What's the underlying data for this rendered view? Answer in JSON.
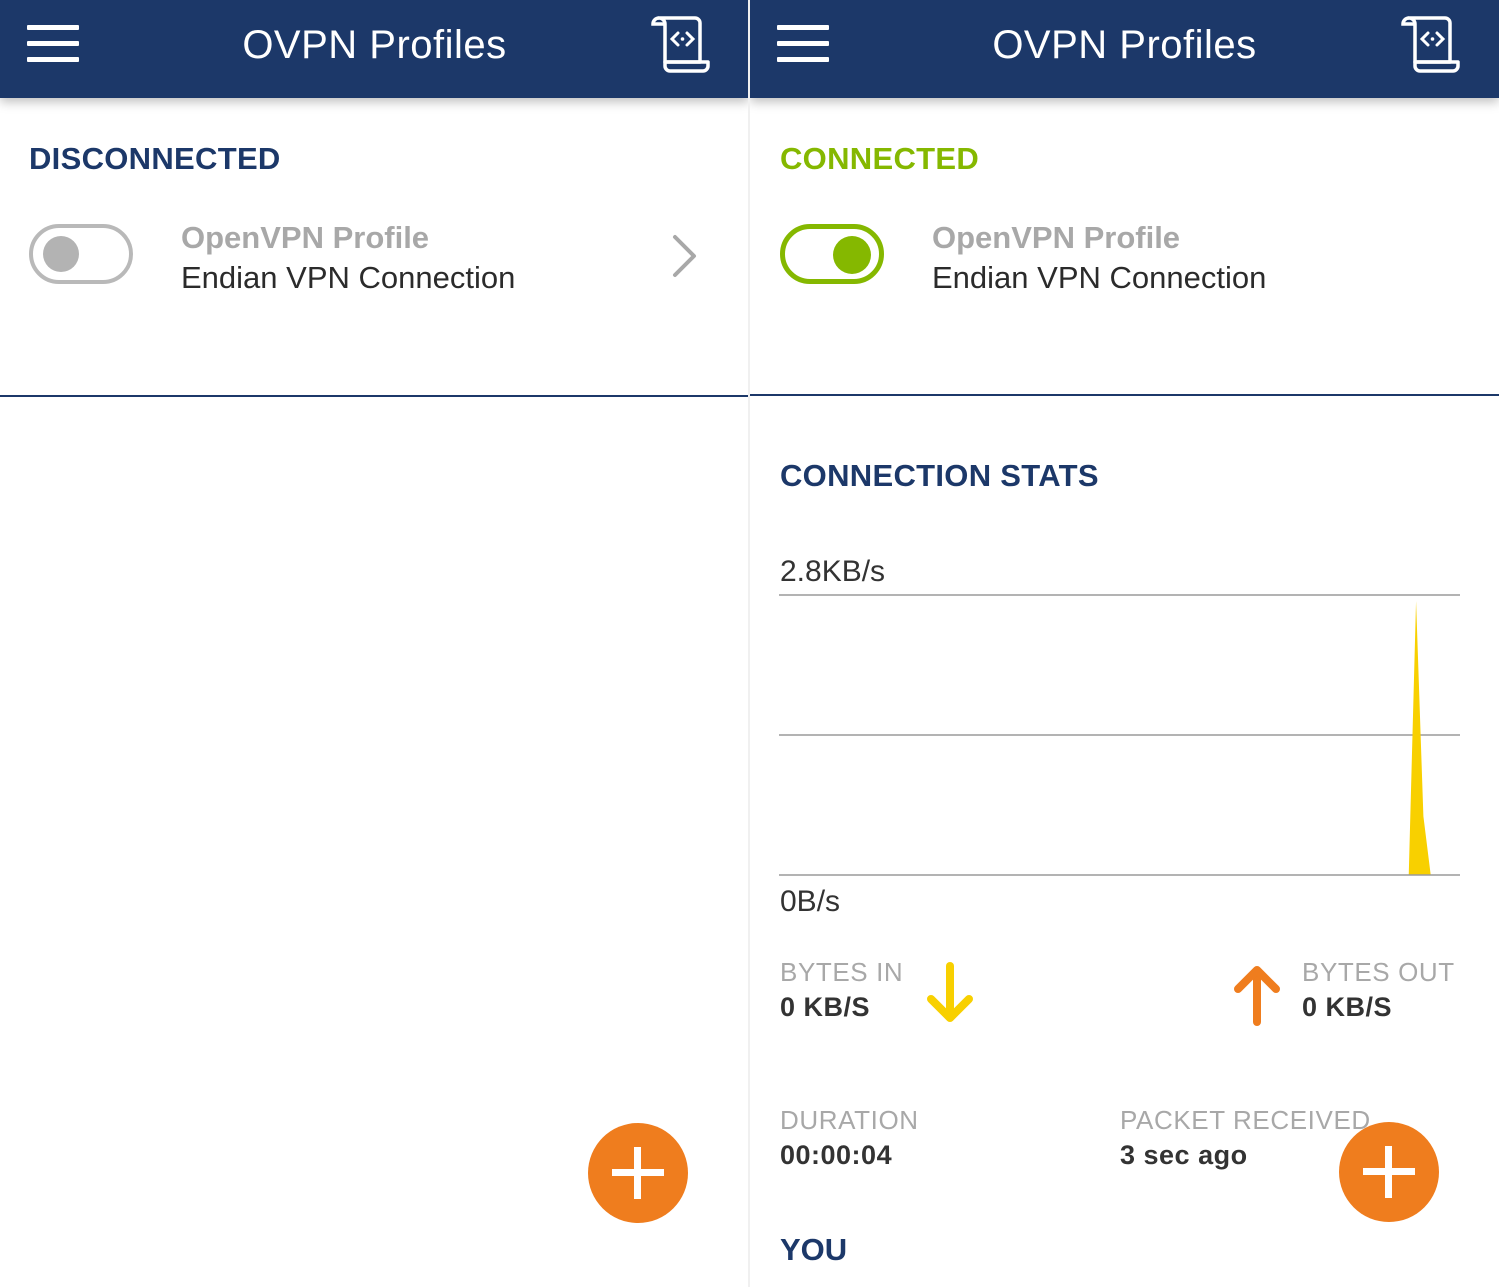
{
  "left_panel": {
    "app_bar": {
      "title": "OVPN Profiles"
    },
    "status": "DISCONNECTED",
    "status_color": "#1c3869",
    "profile": {
      "type_label": "OpenVPN Profile",
      "name": "Endian VPN Connection",
      "toggle_state": "off"
    },
    "fab_icon": "plus-icon"
  },
  "right_panel": {
    "app_bar": {
      "title": "OVPN Profiles"
    },
    "status": "CONNECTED",
    "status_color": "#85b800",
    "profile": {
      "type_label": "OpenVPN Profile",
      "name": "Endian VPN Connection",
      "toggle_state": "on"
    },
    "stats": {
      "title": "CONNECTION STATS",
      "chart_max_label": "2.8KB/s",
      "chart_min_label": "0B/s",
      "bytes_in": {
        "label": "BYTES IN",
        "value": "0 KB/S",
        "icon": "arrow-down-icon",
        "color": "#f8d000"
      },
      "bytes_out": {
        "label": "BYTES OUT",
        "value": "0 KB/S",
        "icon": "arrow-up-icon",
        "color": "#ef7d1e"
      },
      "duration": {
        "label": "DURATION",
        "value": "00:00:04"
      },
      "packet_received": {
        "label": "PACKET RECEIVED",
        "value": "3 sec ago"
      },
      "you_title": "YOU"
    },
    "fab_icon": "plus-icon"
  },
  "colors": {
    "app_bar": "#1c3869",
    "accent_green": "#85b800",
    "fab": "#ef7d1e",
    "chart_fill": "#f8d000"
  },
  "chart_data": {
    "type": "area",
    "ylim": [
      0,
      2.8
    ],
    "yticks": [
      "0B/s",
      "2.8KB/s"
    ],
    "series": [
      {
        "values": [
          0,
          0,
          0,
          0,
          0,
          0,
          0,
          0,
          0,
          0,
          0,
          0,
          0,
          0,
          0,
          0,
          0,
          0,
          0,
          0,
          0,
          0,
          0,
          0,
          0,
          0,
          0,
          0,
          0,
          0,
          0,
          0,
          0,
          0,
          0,
          0,
          0,
          0,
          0,
          0,
          0,
          0,
          0,
          0,
          0,
          0,
          0,
          0,
          0,
          0,
          0,
          0,
          0,
          0,
          0,
          0,
          0,
          0,
          0,
          0,
          0,
          0,
          0,
          0,
          0,
          0,
          0,
          0,
          0,
          0,
          0,
          0,
          0,
          0,
          0,
          0,
          0,
          0,
          0,
          0,
          0,
          0,
          0,
          0,
          0,
          0,
          0,
          2.8,
          0.6,
          0,
          0,
          0,
          0,
          0
        ]
      }
    ]
  }
}
